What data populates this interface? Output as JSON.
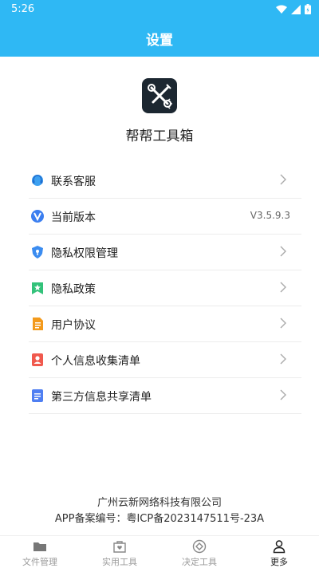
{
  "status": {
    "time": "5:26"
  },
  "header": {
    "title": "设置"
  },
  "app": {
    "name": "帮帮工具箱"
  },
  "menu": [
    {
      "label": "联系客服",
      "icon": "headset-icon",
      "chevron": true
    },
    {
      "label": "当前版本",
      "icon": "version-v-icon",
      "value": "V3.5.9.3"
    },
    {
      "label": "隐私权限管理",
      "icon": "shield-icon",
      "chevron": true
    },
    {
      "label": "隐私政策",
      "icon": "bookmark-star-icon",
      "chevron": true
    },
    {
      "label": "用户协议",
      "icon": "document-icon",
      "chevron": true
    },
    {
      "label": "个人信息收集清单",
      "icon": "person-card-icon",
      "chevron": true
    },
    {
      "label": "第三方信息共享清单",
      "icon": "list-document-icon",
      "chevron": true
    }
  ],
  "footer": {
    "company": "广州云新网络科技有限公司",
    "icp": "APP备案编号：粤ICP备2023147511号-23A"
  },
  "tabs": [
    {
      "label": "文件管理",
      "icon": "folder-icon",
      "active": false
    },
    {
      "label": "实用工具",
      "icon": "toolbox-heart-icon",
      "active": false
    },
    {
      "label": "决定工具",
      "icon": "decision-diamond-icon",
      "active": false
    },
    {
      "label": "更多",
      "icon": "person-icon",
      "active": true
    }
  ],
  "colors": {
    "accent": "#2fb8f4"
  }
}
